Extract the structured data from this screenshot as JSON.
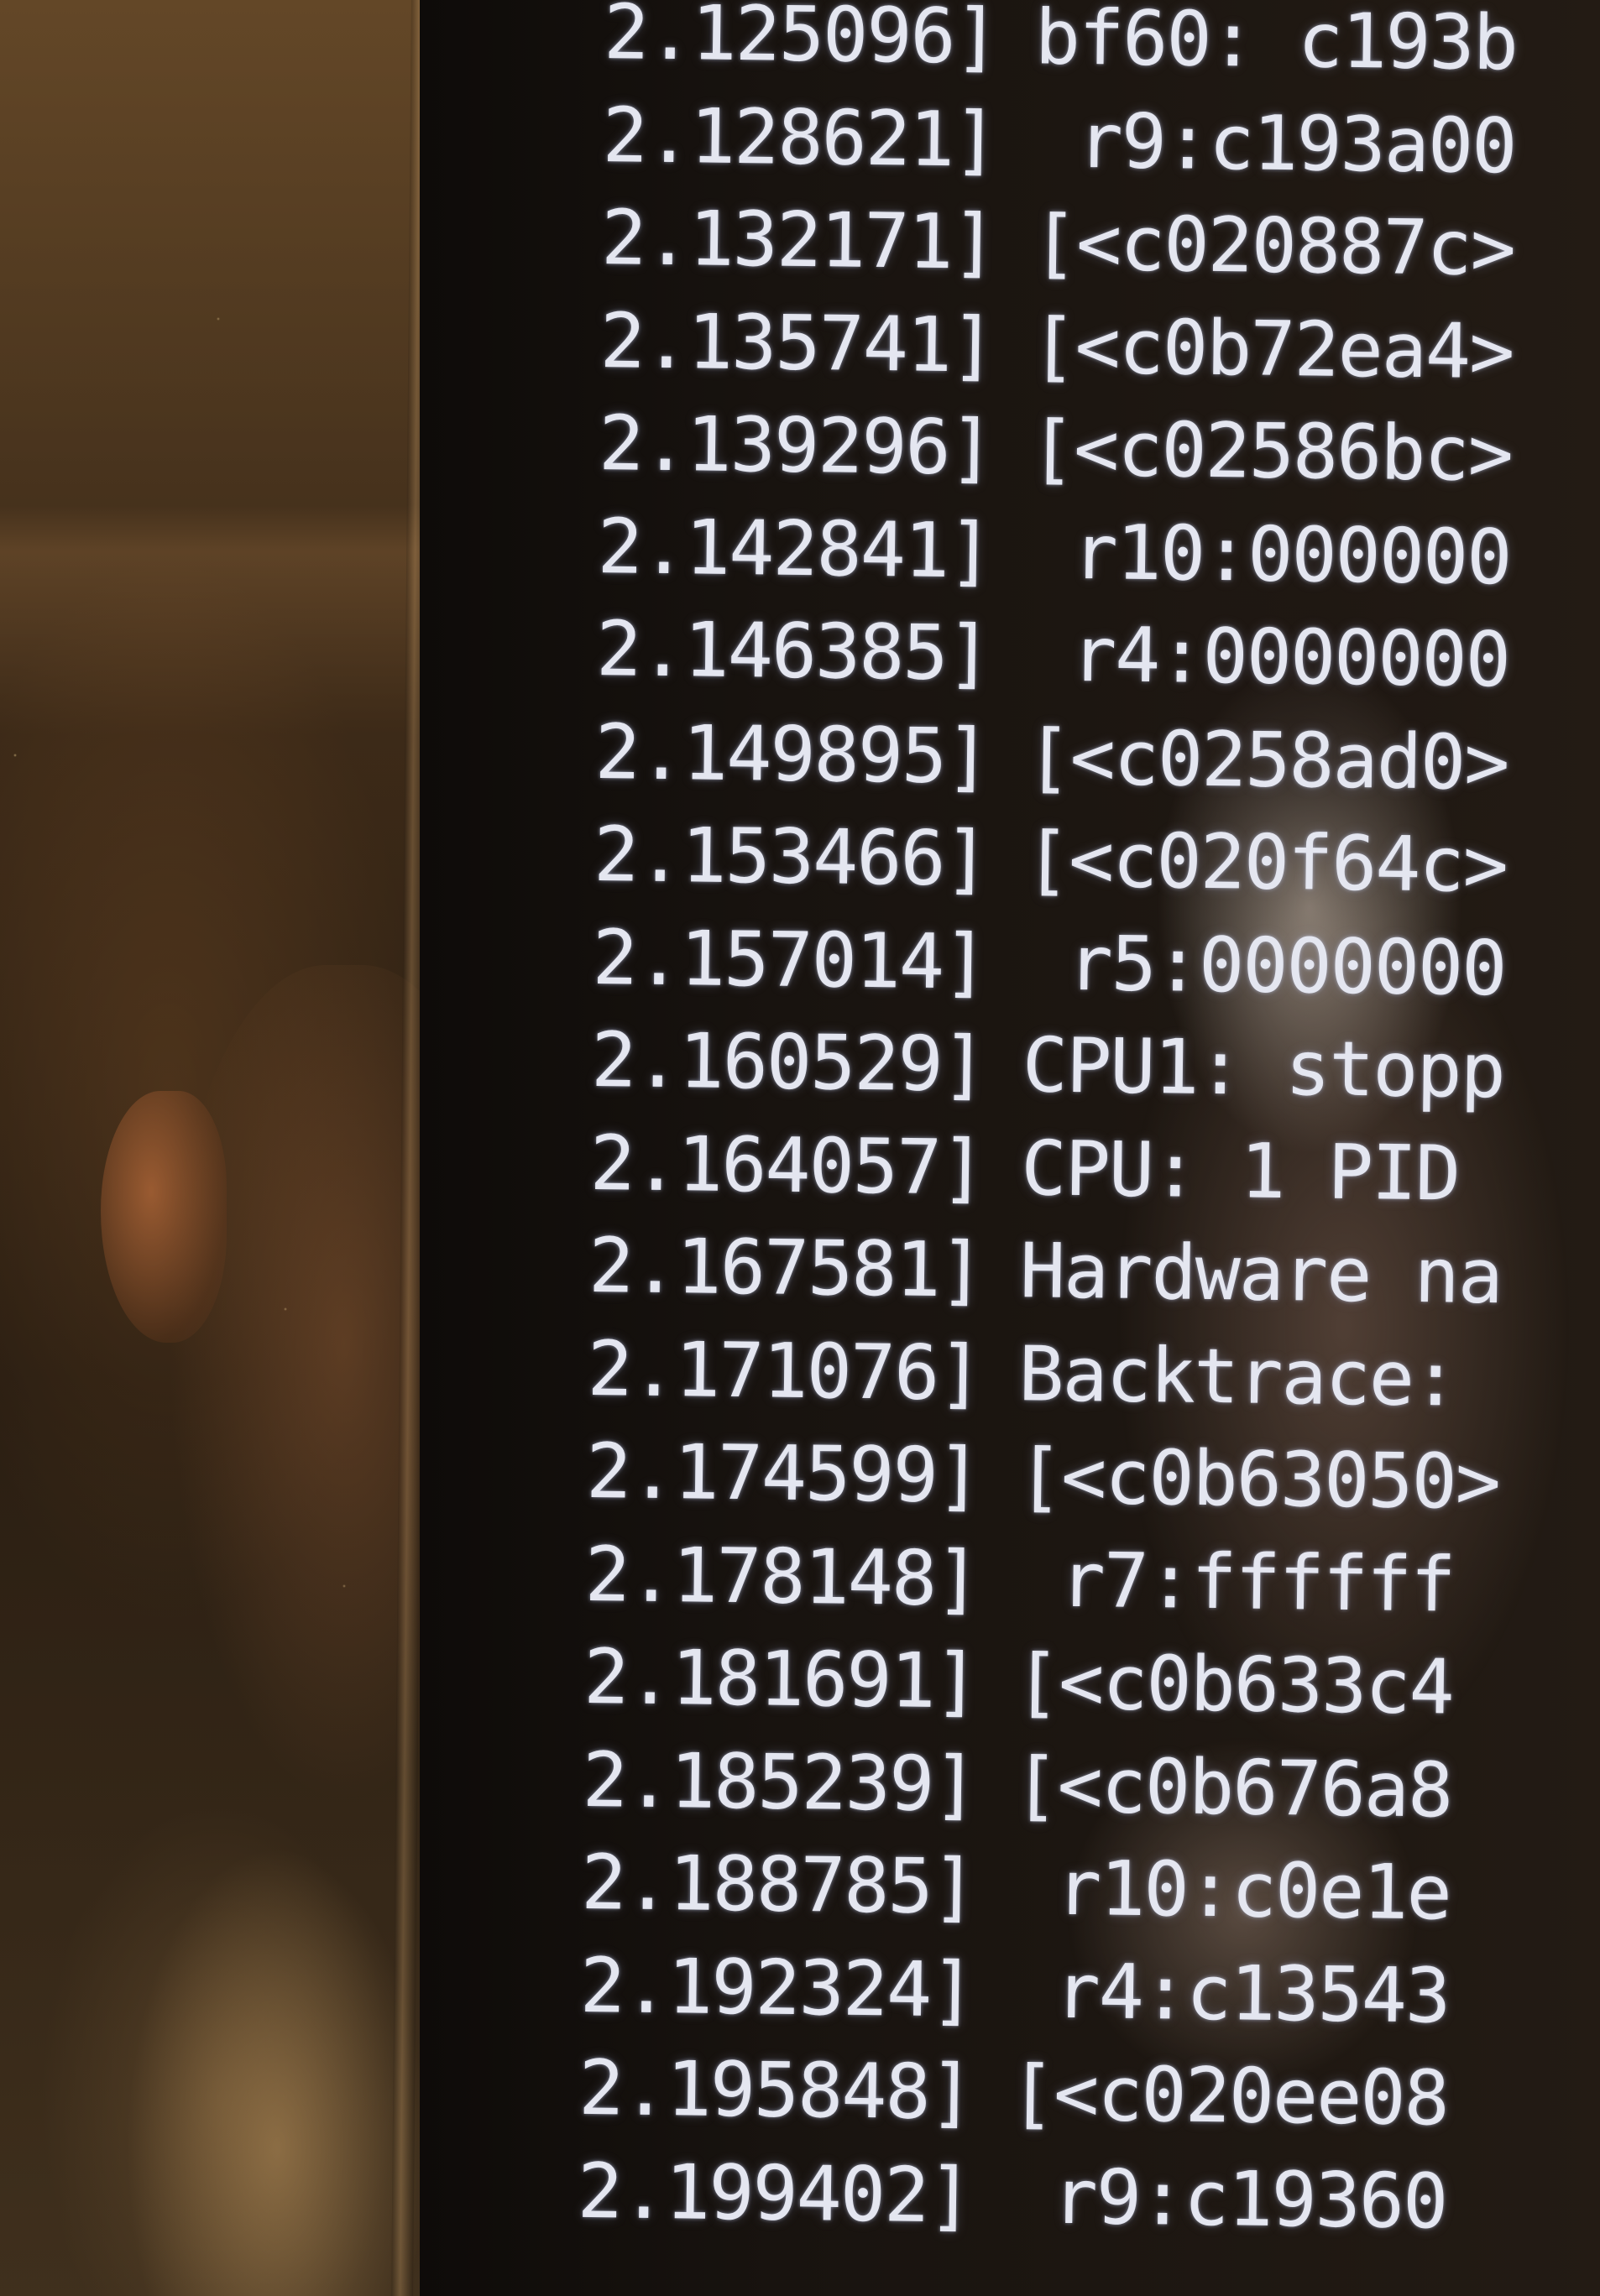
{
  "photo": {
    "subject": "kernel-log-on-monitor-with-face-reflection",
    "colors": {
      "text": "#e4e6f0",
      "screen": "#18130f",
      "bezel": "#3b2a18"
    }
  },
  "console": {
    "lines": [
      {
        "ts": "2.125096]",
        "msg": "bf60: c193b"
      },
      {
        "ts": "2.128621]",
        "msg": " r9:c193a00"
      },
      {
        "ts": "2.132171]",
        "msg": "[<c020887c>"
      },
      {
        "ts": "2.135741]",
        "msg": "[<c0b72ea4>"
      },
      {
        "ts": "2.139296]",
        "msg": "[<c02586bc>"
      },
      {
        "ts": "2.142841]",
        "msg": " r10:000000"
      },
      {
        "ts": "2.146385]",
        "msg": " r4:0000000"
      },
      {
        "ts": "2.149895]",
        "msg": "[<c0258ad0>"
      },
      {
        "ts": "2.153466]",
        "msg": "[<c020f64c>"
      },
      {
        "ts": "2.157014]",
        "msg": " r5:0000000"
      },
      {
        "ts": "2.160529]",
        "msg": "CPU1: stopp"
      },
      {
        "ts": "2.164057]",
        "msg": "CPU: 1 PID"
      },
      {
        "ts": "2.167581]",
        "msg": "Hardware na"
      },
      {
        "ts": "2.171076]",
        "msg": "Backtrace:"
      },
      {
        "ts": "2.174599]",
        "msg": "[<c0b63050>"
      },
      {
        "ts": "2.178148]",
        "msg": " r7:ffffff"
      },
      {
        "ts": "2.181691]",
        "msg": "[<c0b633c4"
      },
      {
        "ts": "2.185239]",
        "msg": "[<c0b676a8"
      },
      {
        "ts": "2.188785]",
        "msg": " r10:c0e1e"
      },
      {
        "ts": "2.192324]",
        "msg": " r4:c13543"
      },
      {
        "ts": "2.195848]",
        "msg": "[<c020ee08"
      },
      {
        "ts": "2.199402]",
        "msg": " r9:c19360"
      }
    ]
  }
}
